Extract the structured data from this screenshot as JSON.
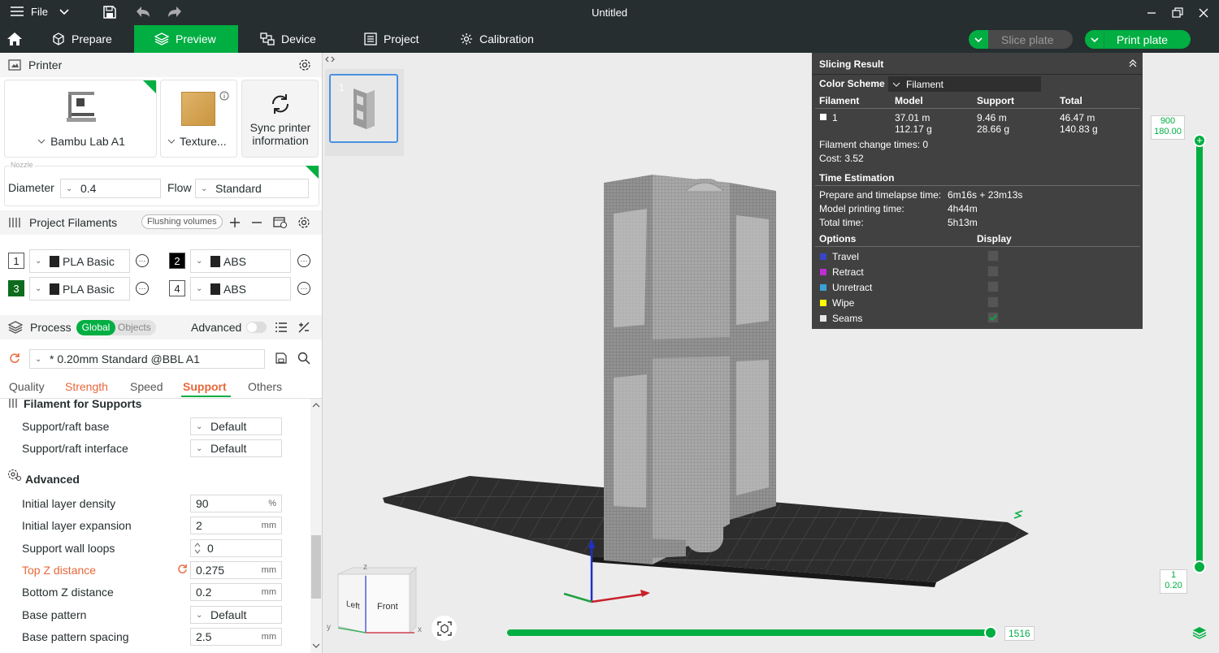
{
  "titlebar": {
    "file_label": "File",
    "title": "Untitled"
  },
  "tabs": [
    {
      "label": "Prepare"
    },
    {
      "label": "Preview"
    },
    {
      "label": "Device"
    },
    {
      "label": "Project"
    },
    {
      "label": "Calibration"
    }
  ],
  "actions": {
    "slice_label": "Slice plate",
    "print_label": "Print plate"
  },
  "printer": {
    "section_title": "Printer",
    "name": "Bambu Lab A1",
    "plate": "Texture...",
    "sync_label": "Sync printer information",
    "nozzle_label": "Nozzle",
    "diameter_label": "Diameter",
    "diameter_value": "0.4",
    "flow_label": "Flow",
    "flow_value": "Standard"
  },
  "filaments": {
    "section_title": "Project Filaments",
    "flushing_label": "Flushing volumes",
    "items": [
      {
        "num": "1",
        "name": "PLA Basic"
      },
      {
        "num": "2",
        "name": "ABS"
      },
      {
        "num": "3",
        "name": "PLA Basic"
      },
      {
        "num": "4",
        "name": "ABS"
      }
    ]
  },
  "process": {
    "section_title": "Process",
    "global_label": "Global",
    "objects_label": "Objects",
    "advanced_label": "Advanced",
    "preset": "* 0.20mm Standard @BBL A1",
    "tabs": [
      "Quality",
      "Strength",
      "Speed",
      "Support",
      "Others"
    ],
    "group1_title": "Filament for Supports",
    "raft_base_label": "Support/raft base",
    "raft_base_value": "Default",
    "raft_interface_label": "Support/raft interface",
    "raft_interface_value": "Default",
    "group2_title": "Advanced",
    "params": [
      {
        "label": "Initial layer density",
        "value": "90",
        "unit": "%"
      },
      {
        "label": "Initial layer expansion",
        "value": "2",
        "unit": "mm"
      },
      {
        "label": "Support wall loops",
        "value": "0",
        "unit": ""
      },
      {
        "label": "Top Z distance",
        "value": "0.275",
        "unit": "mm"
      },
      {
        "label": "Bottom Z distance",
        "value": "0.2",
        "unit": "mm"
      },
      {
        "label": "Base pattern",
        "value": "Default",
        "unit": ""
      },
      {
        "label": "Base pattern spacing",
        "value": "2.5",
        "unit": "mm"
      }
    ]
  },
  "plate_thumb": {
    "number": "1"
  },
  "slicing": {
    "title": "Slicing Result",
    "color_scheme_label": "Color Scheme",
    "color_scheme_value": "Filament",
    "headers": [
      "Filament",
      "Model",
      "Support",
      "Total"
    ],
    "row": {
      "id": "1",
      "model_len": "37.01 m",
      "model_wt": "112.17 g",
      "support_len": "9.46 m",
      "support_wt": "28.66 g",
      "total_len": "46.47 m",
      "total_wt": "140.83 g"
    },
    "change_times": "Filament change times:  0",
    "cost": "Cost:  3.52",
    "time_title": "Time Estimation",
    "times": [
      {
        "label": "Prepare and timelapse time:",
        "value": "6m16s + 23m13s"
      },
      {
        "label": "Model printing time:",
        "value": "4h44m"
      },
      {
        "label": "Total time:",
        "value": "5h13m"
      }
    ],
    "options_label": "Options",
    "display_label": "Display",
    "options": [
      {
        "name": "Travel",
        "color": "#3845c8",
        "checked": false
      },
      {
        "name": "Retract",
        "color": "#c02dd4",
        "checked": false
      },
      {
        "name": "Unretract",
        "color": "#3aa0d9",
        "checked": false
      },
      {
        "name": "Wipe",
        "color": "#ffff00",
        "checked": false
      },
      {
        "name": "Seams",
        "color": "#e6e6e6",
        "checked": true
      }
    ]
  },
  "layer_slider": {
    "top_layer": "900",
    "top_height": "180.00",
    "bottom_layer": "1",
    "bottom_height": "0.20"
  },
  "move_slider": {
    "value": "1516"
  },
  "view_cube": {
    "left": "Left",
    "front": "Front",
    "axis_x": "x",
    "axis_y": "y",
    "axis_z": "z"
  }
}
